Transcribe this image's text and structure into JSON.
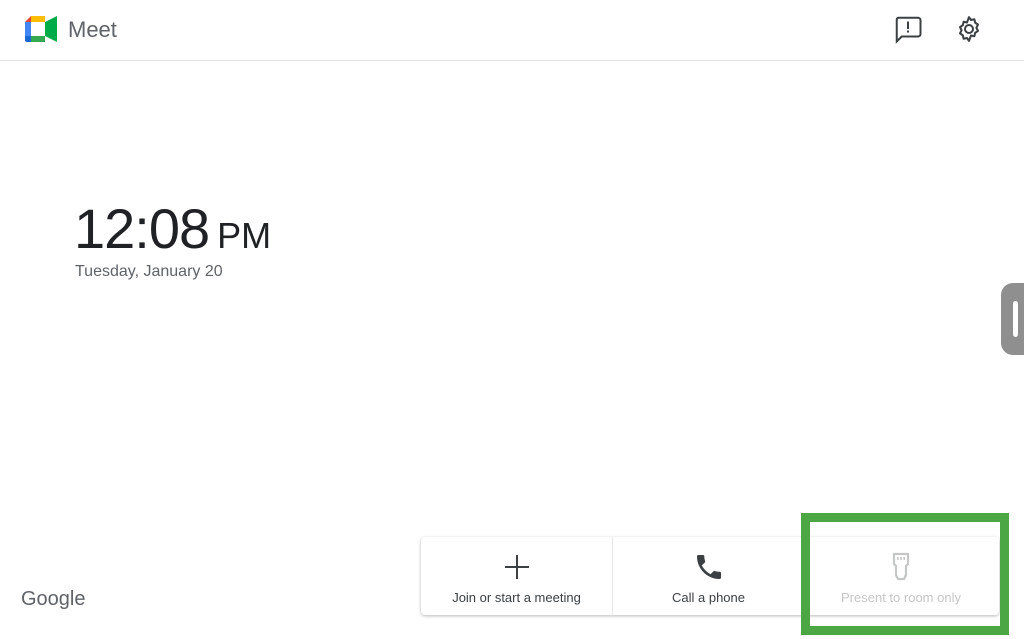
{
  "app": {
    "name": "Meet"
  },
  "header": {
    "icons": [
      "feedback-icon",
      "settings-icon"
    ]
  },
  "clock": {
    "time": "12:08",
    "ampm": "PM",
    "date": "Tuesday, January 20"
  },
  "footer": {
    "brand": "Google"
  },
  "actions": [
    {
      "label": "Join or start a meeting",
      "icon": "plus-icon",
      "enabled": true
    },
    {
      "label": "Call a phone",
      "icon": "phone-icon",
      "enabled": true
    },
    {
      "label": "Present to room only",
      "icon": "hdmi-icon",
      "enabled": false
    }
  ],
  "colors": {
    "highlight": "#4ca644",
    "text_primary": "#202124",
    "text_secondary": "#5f6368",
    "disabled": "#c4c7c5"
  }
}
